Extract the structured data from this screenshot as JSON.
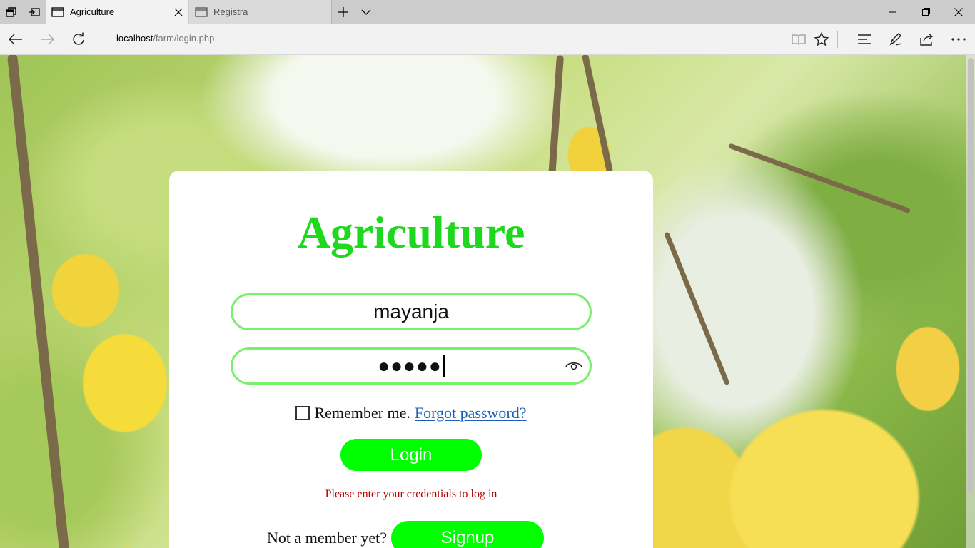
{
  "browser": {
    "tabs": [
      {
        "title": "Agriculture",
        "active": true
      },
      {
        "title": "Registra",
        "active": false
      }
    ],
    "address": {
      "host": "localhost",
      "path": "/farm/login.php"
    }
  },
  "login": {
    "brand": "Agriculture",
    "username_value": "mayanja",
    "password_mask": "●●●●●",
    "remember_label": "Remember me.",
    "forgot_link": "Forgot password?",
    "login_button": "Login",
    "message": "Please enter your credentials to log in",
    "not_member_text": "Not a member yet?",
    "signup_button": "Signup"
  },
  "colors": {
    "brand": "#1ed81e",
    "button": "#00ff00",
    "field_border": "#77f06a",
    "message": "#b30000",
    "link": "#1b5fb9"
  }
}
